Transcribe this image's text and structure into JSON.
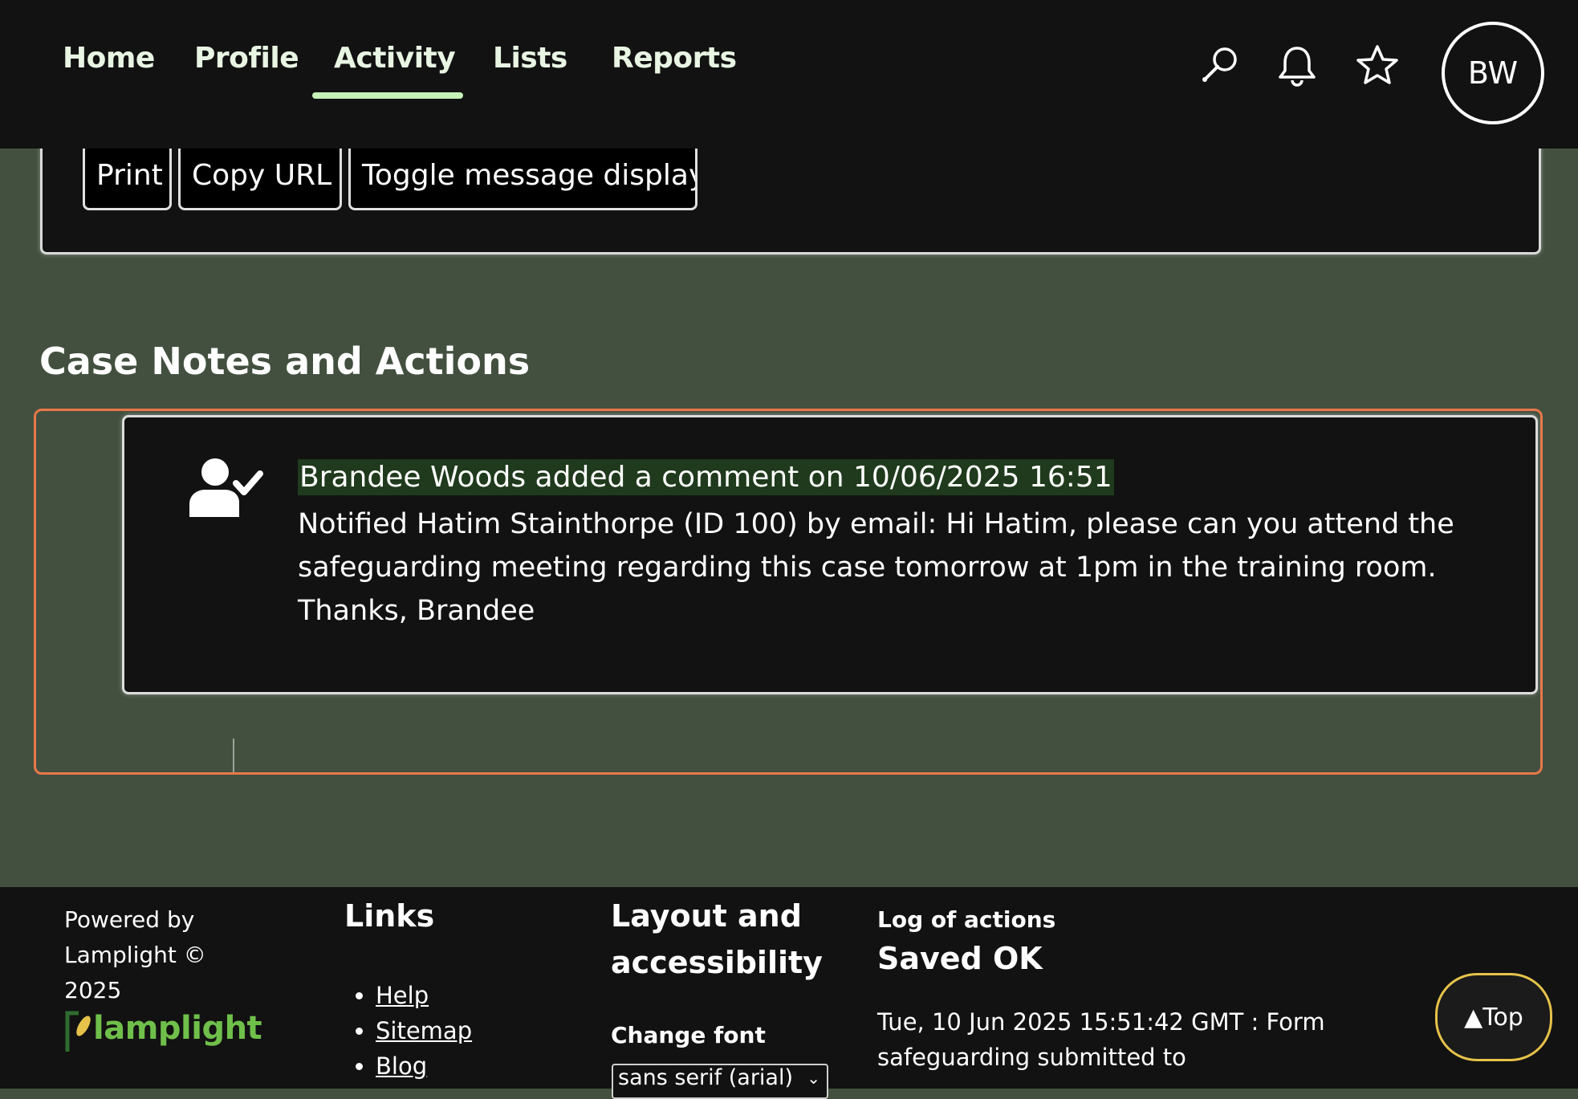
{
  "nav": {
    "items": [
      "Home",
      "Profile",
      "Activity",
      "Lists",
      "Reports"
    ],
    "active": "Activity",
    "icons": [
      "search-icon",
      "bell-icon",
      "star-icon"
    ],
    "avatar_initials": "BW"
  },
  "toolbar": {
    "buttons": [
      "Print",
      "Copy URL",
      "Toggle message display"
    ]
  },
  "section": {
    "title": "Case Notes and Actions"
  },
  "note": {
    "icon": "user-check-icon",
    "heading": "Brandee Woods added a comment on 10/06/2025 16:51",
    "body": "Notified Hatim Stainthorpe (ID 100) by email: Hi Hatim, please can you attend the safeguarding meeting regarding this case tomorrow at 1pm in the training room. Thanks, Brandee"
  },
  "footer": {
    "powered_by": "Powered by Lamplight © 2025",
    "logo_text": "lamplight",
    "links_title": "Links",
    "links": [
      "Help",
      "Sitemap",
      "Blog"
    ],
    "layout_title": "Layout and accessibility",
    "change_font_label": "Change font",
    "font_selected": "sans serif (arial)",
    "log_title": "Log of actions",
    "log_status": "Saved OK",
    "log_entry": "Tue, 10 Jun 2025 15:51:42 GMT : Form safeguarding submitted to"
  },
  "top_button": "▲Top",
  "colors": {
    "page_bg": "#43503f",
    "panel_bg": "#121212",
    "accent_underline": "#c6f2b8",
    "frame_orange": "#e8784a",
    "highlight": "#1f3a1c",
    "top_button_border": "#e6c24a"
  }
}
